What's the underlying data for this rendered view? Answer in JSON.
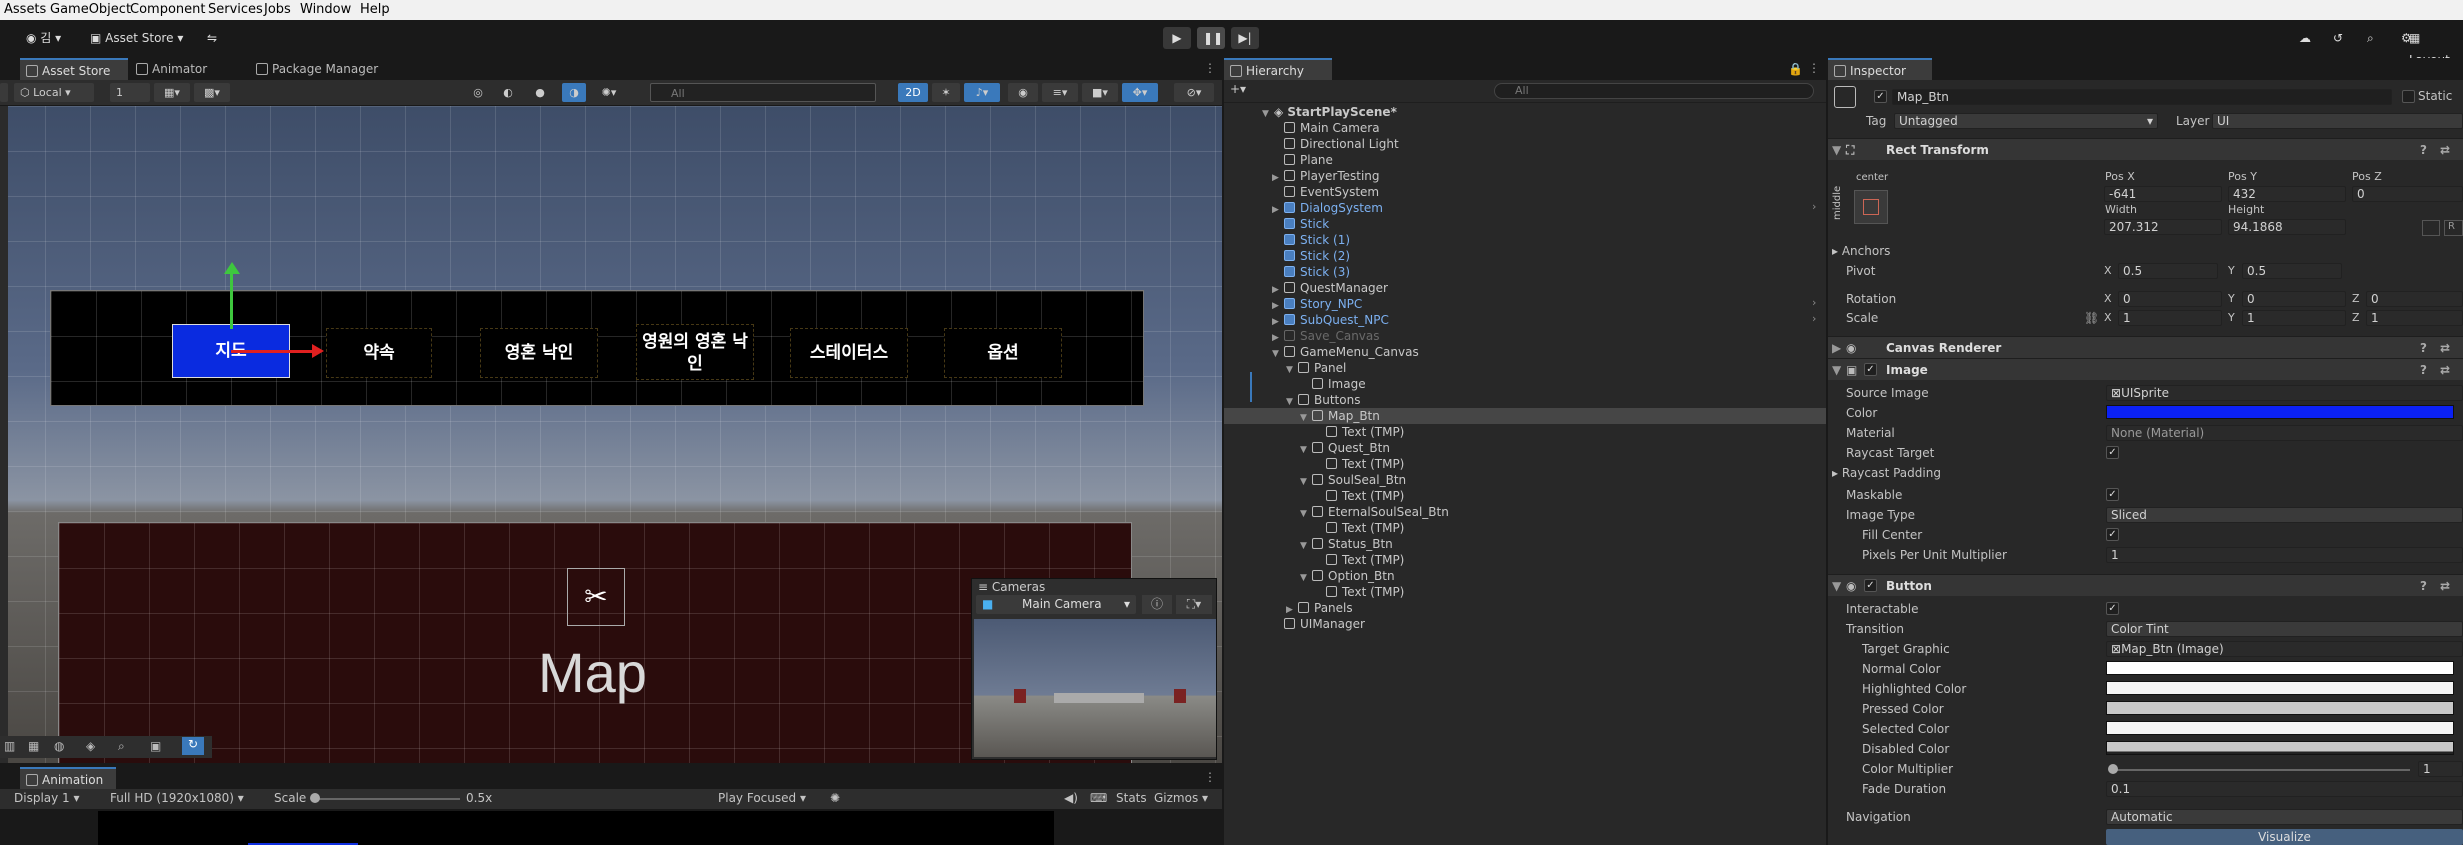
{
  "menu": [
    "Assets",
    "GameObject",
    "Component",
    "Services",
    "Jobs",
    "Window",
    "Help"
  ],
  "toolbar": {
    "account": "김",
    "asset_store": "Asset Store",
    "layout": "Layout"
  },
  "scene_tabs": {
    "asset_store": "Asset Store",
    "animator": "Animator",
    "package_manager": "Package Manager"
  },
  "scene_toolbar": {
    "pivot_mode": "Local",
    "grid_size": "1",
    "search_placeholder": "All",
    "mode_2d": "2D"
  },
  "scene_view": {
    "buttons": [
      "지도",
      "약속",
      "영혼 낙인",
      "영원의 영혼 낙인",
      "스테이터스",
      "옵션"
    ],
    "map_label": "Map",
    "accent_blue": "#0a2be0"
  },
  "cameras_overlay": {
    "title": "Cameras",
    "camera": "Main Camera"
  },
  "game_view": {
    "tab": "Animation",
    "display": "Display 1",
    "resolution": "Full HD (1920x1080)",
    "scale_label": "Scale",
    "scale_value": "0.5x",
    "play_mode": "Play Focused",
    "stats": "Stats",
    "gizmos": "Gizmos"
  },
  "hierarchy": {
    "title": "Hierarchy",
    "search_placeholder": "All",
    "scene": "StartPlayScene*",
    "items": [
      {
        "label": "Main Camera",
        "depth": 1,
        "style": "normal",
        "arrow": ""
      },
      {
        "label": "Directional Light",
        "depth": 1,
        "style": "normal",
        "arrow": ""
      },
      {
        "label": "Plane",
        "depth": 1,
        "style": "normal",
        "arrow": ""
      },
      {
        "label": "PlayerTesting",
        "depth": 1,
        "style": "normal",
        "arrow": "▶"
      },
      {
        "label": "EventSystem",
        "depth": 1,
        "style": "normal",
        "arrow": ""
      },
      {
        "label": "DialogSystem",
        "depth": 1,
        "style": "blue",
        "arrow": "▶"
      },
      {
        "label": "Stick",
        "depth": 1,
        "style": "blue",
        "arrow": ""
      },
      {
        "label": "Stick (1)",
        "depth": 1,
        "style": "blue",
        "arrow": ""
      },
      {
        "label": "Stick (2)",
        "depth": 1,
        "style": "blue",
        "arrow": ""
      },
      {
        "label": "Stick (3)",
        "depth": 1,
        "style": "blue",
        "arrow": ""
      },
      {
        "label": "QuestManager",
        "depth": 1,
        "style": "normal",
        "arrow": "▶"
      },
      {
        "label": "Story_NPC",
        "depth": 1,
        "style": "blue",
        "arrow": "▶"
      },
      {
        "label": "SubQuest_NPC",
        "depth": 1,
        "style": "blue",
        "arrow": "▶"
      },
      {
        "label": "Save_Canvas",
        "depth": 1,
        "style": "dim",
        "arrow": "▶"
      },
      {
        "label": "GameMenu_Canvas",
        "depth": 1,
        "style": "normal",
        "arrow": "▼"
      },
      {
        "label": "Panel",
        "depth": 2,
        "style": "normal",
        "arrow": "▼"
      },
      {
        "label": "Image",
        "depth": 3,
        "style": "normal",
        "arrow": ""
      },
      {
        "label": "Buttons",
        "depth": 2,
        "style": "normal",
        "arrow": "▼"
      },
      {
        "label": "Map_Btn",
        "depth": 3,
        "style": "selected",
        "arrow": "▼"
      },
      {
        "label": "Text (TMP)",
        "depth": 4,
        "style": "normal",
        "arrow": ""
      },
      {
        "label": "Quest_Btn",
        "depth": 3,
        "style": "normal",
        "arrow": "▼"
      },
      {
        "label": "Text (TMP)",
        "depth": 4,
        "style": "normal",
        "arrow": ""
      },
      {
        "label": "SoulSeal_Btn",
        "depth": 3,
        "style": "normal",
        "arrow": "▼"
      },
      {
        "label": "Text (TMP)",
        "depth": 4,
        "style": "normal",
        "arrow": ""
      },
      {
        "label": "EternalSoulSeal_Btn",
        "depth": 3,
        "style": "normal",
        "arrow": "▼"
      },
      {
        "label": "Text (TMP)",
        "depth": 4,
        "style": "normal",
        "arrow": ""
      },
      {
        "label": "Status_Btn",
        "depth": 3,
        "style": "normal",
        "arrow": "▼"
      },
      {
        "label": "Text (TMP)",
        "depth": 4,
        "style": "normal",
        "arrow": ""
      },
      {
        "label": "Option_Btn",
        "depth": 3,
        "style": "normal",
        "arrow": "▼"
      },
      {
        "label": "Text (TMP)",
        "depth": 4,
        "style": "normal",
        "arrow": ""
      },
      {
        "label": "Panels",
        "depth": 2,
        "style": "normal",
        "arrow": "▶"
      },
      {
        "label": "UIManager",
        "depth": 1,
        "style": "normal",
        "arrow": ""
      }
    ]
  },
  "inspector": {
    "title": "Inspector",
    "object_name": "Map_Btn",
    "static_label": "Static",
    "tag_label": "Tag",
    "tag_value": "Untagged",
    "layer_label": "Layer",
    "layer_value": "UI",
    "rect_transform": {
      "title": "Rect Transform",
      "anchor_preset_h": "center",
      "anchor_preset_v": "middle",
      "pos_x_label": "Pos X",
      "pos_x": "-641",
      "pos_y_label": "Pos Y",
      "pos_y": "432",
      "pos_z_label": "Pos Z",
      "pos_z": "0",
      "width_label": "Width",
      "width": "207.312",
      "height_label": "Height",
      "height": "94.1868",
      "anchors_label": "Anchors",
      "pivot_label": "Pivot",
      "pivot_x": "0.5",
      "pivot_y": "0.5",
      "rotation_label": "Rotation",
      "rot_x": "0",
      "rot_y": "0",
      "rot_z": "0",
      "scale_label": "Scale",
      "scale_x": "1",
      "scale_y": "1",
      "scale_z": "1",
      "x": "X",
      "y": "Y",
      "z": "Z"
    },
    "canvas_renderer": {
      "title": "Canvas Renderer"
    },
    "image": {
      "title": "Image",
      "source_image_label": "Source Image",
      "source_image": "UISprite",
      "color_label": "Color",
      "color": "#0b21f5",
      "material_label": "Material",
      "material": "None (Material)",
      "raycast_target_label": "Raycast Target",
      "raycast_padding_label": "Raycast Padding",
      "maskable_label": "Maskable",
      "image_type_label": "Image Type",
      "image_type": "Sliced",
      "fill_center_label": "Fill Center",
      "ppu_label": "Pixels Per Unit Multiplier",
      "ppu": "1"
    },
    "button": {
      "title": "Button",
      "interactable_label": "Interactable",
      "transition_label": "Transition",
      "transition": "Color Tint",
      "target_graphic_label": "Target Graphic",
      "target_graphic": "Map_Btn (Image)",
      "normal_color_label": "Normal Color",
      "highlighted_color_label": "Highlighted Color",
      "pressed_color_label": "Pressed Color",
      "selected_color_label": "Selected Color",
      "disabled_color_label": "Disabled Color",
      "color_multiplier_label": "Color Multiplier",
      "color_multiplier": "1",
      "fade_duration_label": "Fade Duration",
      "fade_duration": "0.1",
      "navigation_label": "Navigation",
      "navigation": "Automatic",
      "visualize": "Visualize"
    }
  }
}
